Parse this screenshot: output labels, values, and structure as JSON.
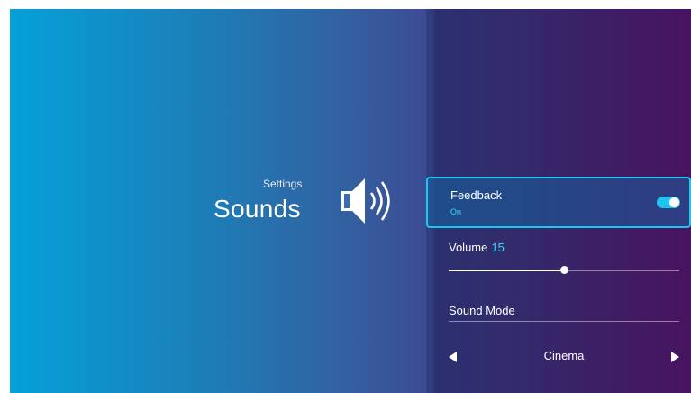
{
  "hero": {
    "category": "Settings",
    "title": "Sounds",
    "icon": "speaker-volume-icon"
  },
  "settings": {
    "feedback": {
      "label": "Feedback",
      "status": "On",
      "enabled": true
    },
    "volume": {
      "label": "Volume",
      "value": "15",
      "level_fraction": 0.5
    },
    "sound_mode": {
      "label": "Sound Mode",
      "selected": "Cinema"
    }
  },
  "colors": {
    "accent": "#19c8ee",
    "accent_text": "#35d6ff",
    "gradient_left": "#05a0d8",
    "gradient_right": "#471460"
  }
}
